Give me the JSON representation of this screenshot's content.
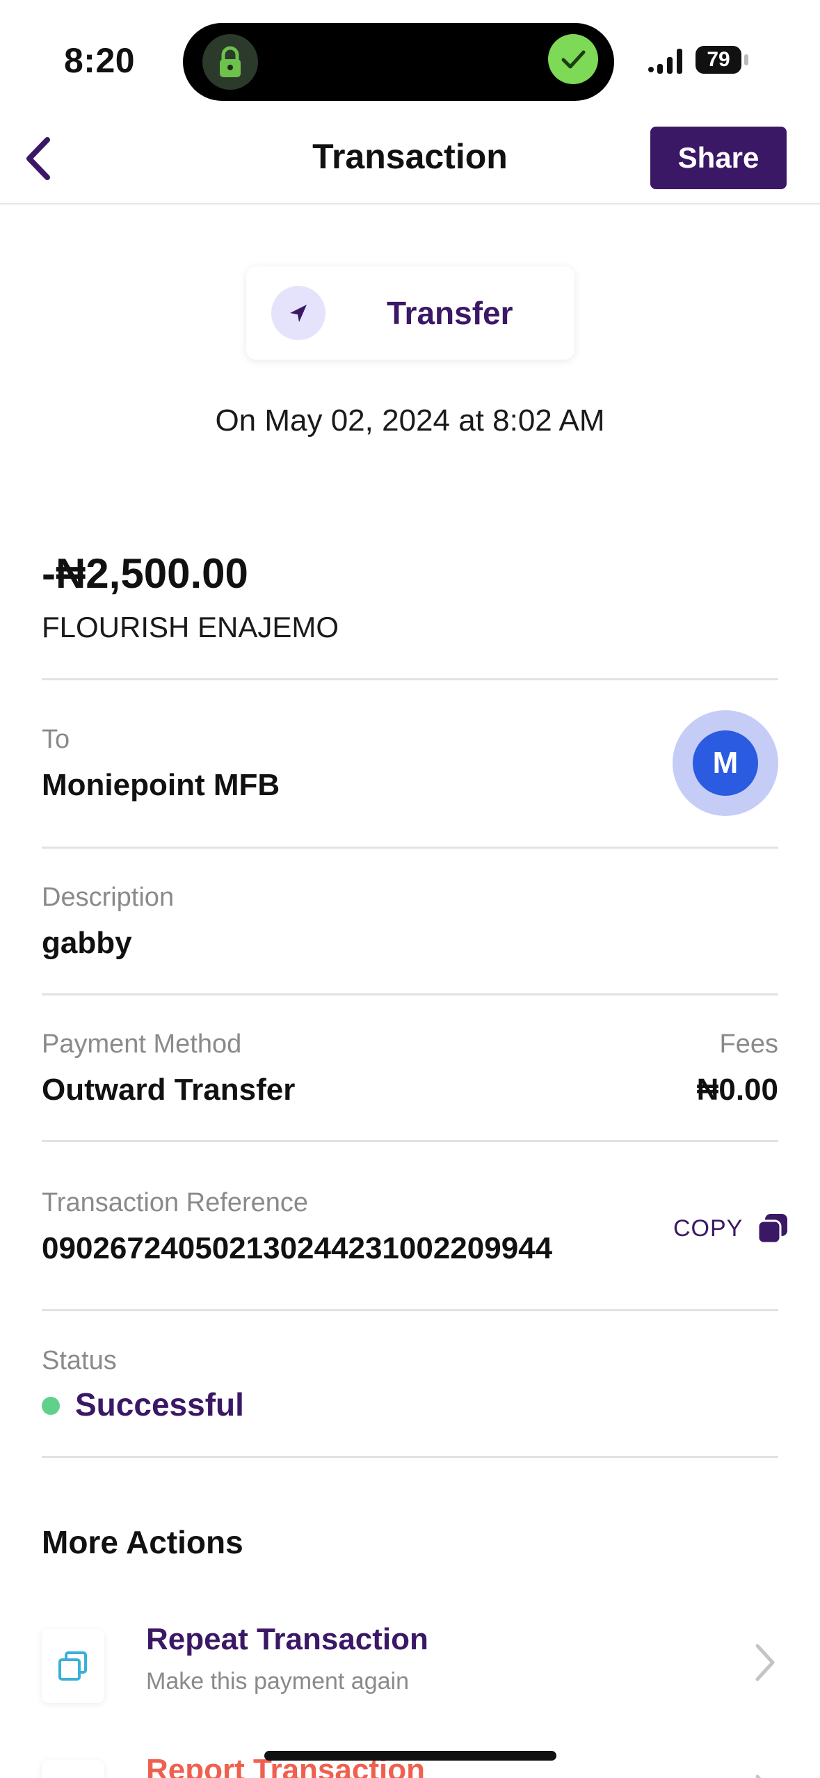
{
  "status_bar": {
    "time": "8:20",
    "battery": "79"
  },
  "header": {
    "title": "Transaction",
    "share_label": "Share"
  },
  "transaction": {
    "type": "Transfer",
    "date": "On May 02, 2024 at 8:02 AM",
    "amount": "-₦2,500.00",
    "counterparty": "FLOURISH ENAJEMO"
  },
  "details": {
    "to_label": "To",
    "to_value": "Moniepoint MFB",
    "bank_initial": "M",
    "description_label": "Description",
    "description_value": "gabby",
    "payment_method_label": "Payment Method",
    "payment_method_value": "Outward Transfer",
    "fees_label": "Fees",
    "fees_value": "₦0.00",
    "reference_label": "Transaction Reference",
    "reference_value": "090267240502130244231002209944",
    "copy_label": "COPY",
    "status_label": "Status",
    "status_value": "Successful"
  },
  "more_actions": {
    "title": "More Actions",
    "items": [
      {
        "title": "Repeat Transaction",
        "subtitle": "Make this payment again",
        "color": "#3b1866"
      },
      {
        "title": "Report Transaction",
        "subtitle": "",
        "color": "#f0604f"
      }
    ]
  },
  "colors": {
    "brand": "#3b1866",
    "success": "#5fd18b",
    "bank": "#2a5be0",
    "danger": "#f0604f"
  }
}
